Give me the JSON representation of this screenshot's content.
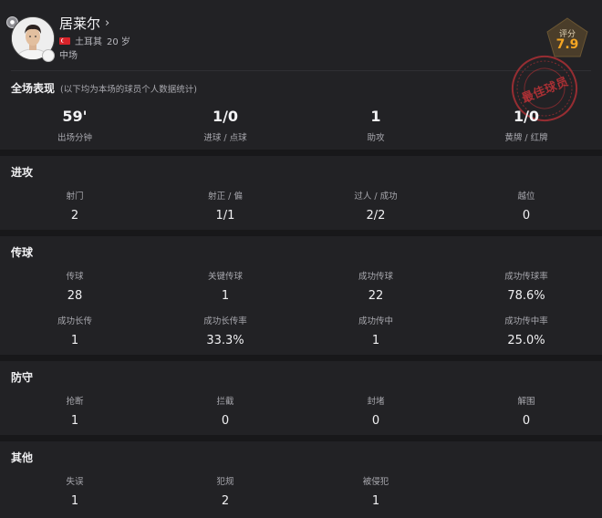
{
  "player": {
    "name": "居莱尔",
    "country": "土耳其",
    "age": "20 岁",
    "position": "中场",
    "rating_label": "评分",
    "rating": "7.9",
    "award": "最佳球员"
  },
  "summary": {
    "title": "全场表现",
    "note": "(以下均为本场的球员个人数据统计)",
    "stats": [
      {
        "label": "出场分钟",
        "value": "59'"
      },
      {
        "label": "进球 / 点球",
        "value": "1/0"
      },
      {
        "label": "助攻",
        "value": "1"
      },
      {
        "label": "黄牌 / 红牌",
        "value": "1/0"
      }
    ]
  },
  "attack": {
    "title": "进攻",
    "stats": [
      {
        "label": "射门",
        "value": "2"
      },
      {
        "label": "射正 / 偏",
        "value": "1/1"
      },
      {
        "label": "过人 / 成功",
        "value": "2/2"
      },
      {
        "label": "越位",
        "value": "0"
      }
    ]
  },
  "passing": {
    "title": "传球",
    "stats": [
      {
        "label": "传球",
        "value": "28"
      },
      {
        "label": "关键传球",
        "value": "1"
      },
      {
        "label": "成功传球",
        "value": "22"
      },
      {
        "label": "成功传球率",
        "value": "78.6%"
      },
      {
        "label": "成功长传",
        "value": "1"
      },
      {
        "label": "成功长传率",
        "value": "33.3%"
      },
      {
        "label": "成功传中",
        "value": "1"
      },
      {
        "label": "成功传中率",
        "value": "25.0%"
      }
    ]
  },
  "defense": {
    "title": "防守",
    "stats": [
      {
        "label": "抢断",
        "value": "1"
      },
      {
        "label": "拦截",
        "value": "0"
      },
      {
        "label": "封堵",
        "value": "0"
      },
      {
        "label": "解围",
        "value": "0"
      }
    ]
  },
  "other": {
    "title": "其他",
    "stats": [
      {
        "label": "失误",
        "value": "1"
      },
      {
        "label": "犯规",
        "value": "2"
      },
      {
        "label": "被侵犯",
        "value": "1"
      }
    ]
  },
  "colors": {
    "background": "#18181a",
    "card": "#222225",
    "rating": "#f5a623",
    "stamp": "#be3237"
  }
}
